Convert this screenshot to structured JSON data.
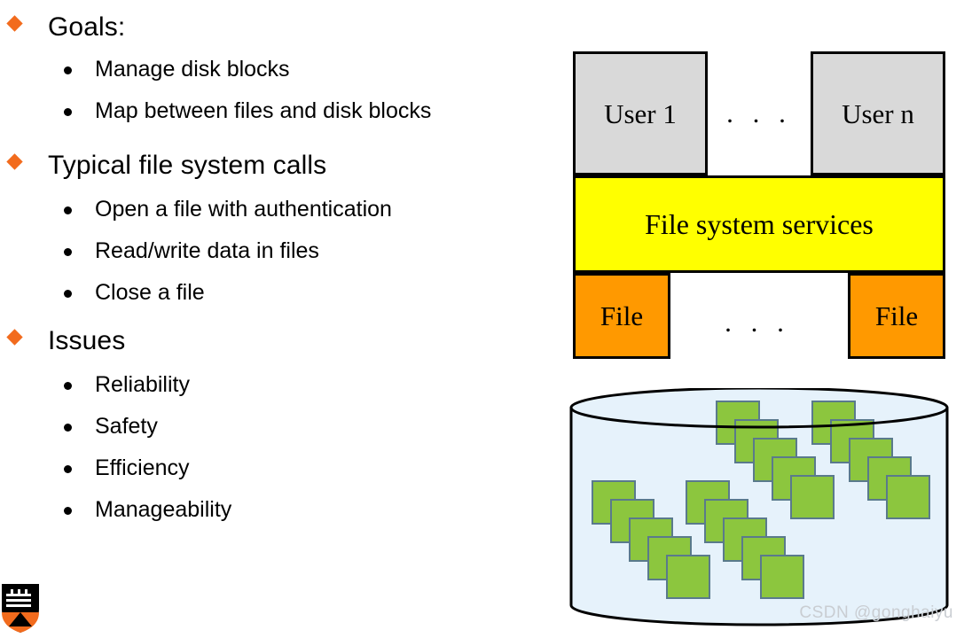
{
  "slide": {
    "bullets": [
      {
        "level": 1,
        "text": "Goals:"
      },
      {
        "level": 2,
        "text": "Manage disk blocks"
      },
      {
        "level": 2,
        "text": "Map between files and disk blocks"
      },
      {
        "level": 1,
        "text": "Typical file system calls"
      },
      {
        "level": 2,
        "text": "Open a file with authentication"
      },
      {
        "level": 2,
        "text": "Read/write data in files"
      },
      {
        "level": 2,
        "text": "Close a file"
      },
      {
        "level": 1,
        "text": "Issues"
      },
      {
        "level": 2,
        "text": "Reliability"
      },
      {
        "level": 2,
        "text": "Safety"
      },
      {
        "level": 2,
        "text": "Efficiency"
      },
      {
        "level": 2,
        "text": "Manageability"
      }
    ]
  },
  "diagram": {
    "user_left": "User 1",
    "user_right": "User n",
    "user_ellipsis": ". . .",
    "file_system_services": "File system services",
    "file_left": "File",
    "file_right": "File",
    "file_ellipsis": ". . .",
    "colors": {
      "user_box": "#D9D9D9",
      "services_box": "#FFFF00",
      "file_box": "#FF9900",
      "outline": "#000000"
    }
  },
  "disk": {
    "label": "disk-cylinder",
    "block_count": 20,
    "chains": 4,
    "blocks_per_chain": 5,
    "colors": {
      "cylinder_fill": "#E6F2FB",
      "cylinder_stroke": "#000000",
      "block_fill": "#8CC63E",
      "block_stroke": "#5A7A8C"
    }
  },
  "watermark": {
    "text": "CSDN @gonghaiyu"
  },
  "logo": {
    "name": "princeton-shield-logo",
    "colors": {
      "shield": "#000000",
      "chevron": "#F26B1D"
    }
  },
  "theme": {
    "bullet_diamond": "#F26B1D",
    "bullet_dot": "#000000",
    "background": "#FFFFFF",
    "text": "#000000"
  }
}
